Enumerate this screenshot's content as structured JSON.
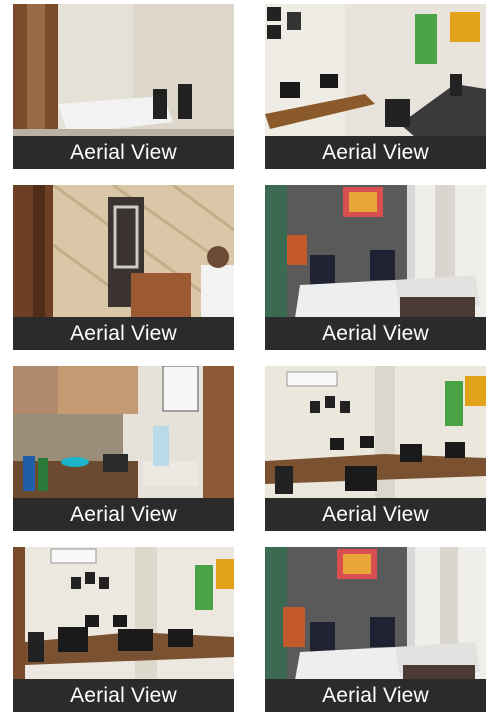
{
  "gallery": {
    "tiles": [
      {
        "caption": "Aerial View",
        "scene": "meeting-room"
      },
      {
        "caption": "Aerial View",
        "scene": "workstations"
      },
      {
        "caption": "Aerial View",
        "scene": "reception-door"
      },
      {
        "caption": "Aerial View",
        "scene": "cabin-desk"
      },
      {
        "caption": "Aerial View",
        "scene": "pantry"
      },
      {
        "caption": "Aerial View",
        "scene": "open-office"
      },
      {
        "caption": "Aerial View",
        "scene": "open-office-wide"
      },
      {
        "caption": "Aerial View",
        "scene": "cabin-desk-2"
      }
    ]
  }
}
